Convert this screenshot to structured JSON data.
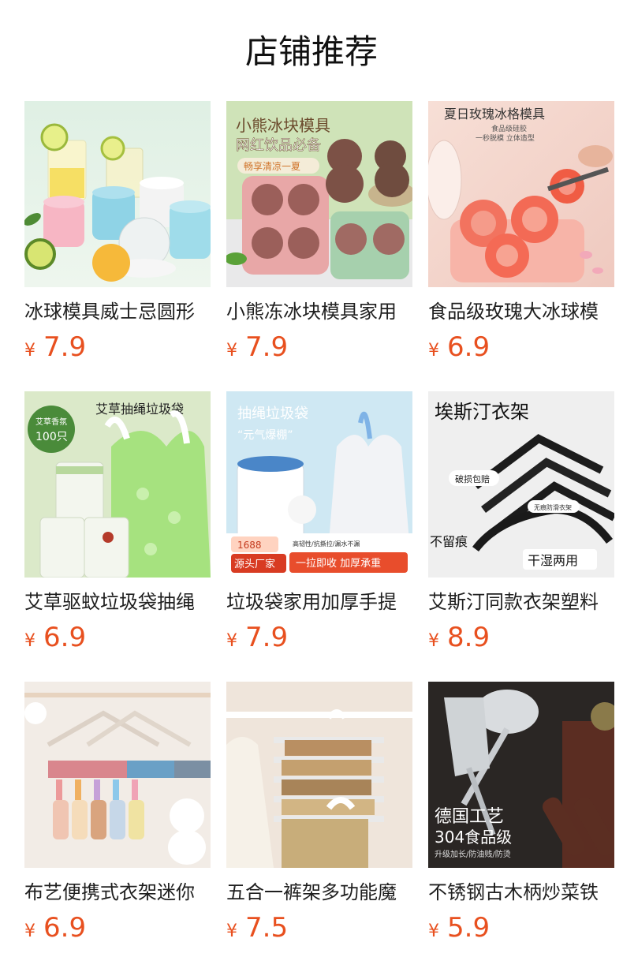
{
  "page": {
    "title": "店铺推荐"
  },
  "colors": {
    "price": "#e8501f",
    "text": "#1f1f1f"
  },
  "products": [
    {
      "name": "冰球模具威士忌圆形",
      "currency": "¥",
      "price": "7.9",
      "image": "ice-ball-molds-image"
    },
    {
      "name": "小熊冻冰块模具家用",
      "currency": "¥",
      "price": "7.9",
      "image": "bear-ice-mold-image",
      "image_text": {
        "line1": "小熊冰块模具",
        "line2": "网红饮品必备",
        "line3": "畅享清凉一夏"
      }
    },
    {
      "name": "食品级玫瑰大冰球模",
      "currency": "¥",
      "price": "6.9",
      "image": "rose-ice-mold-image",
      "image_text": {
        "line1": "夏日玫瑰冰格模具",
        "line2": "食品级硅胶",
        "line3": "一秒脱模 立体造型"
      }
    },
    {
      "name": "艾草驱蚊垃圾袋抽绳",
      "currency": "¥",
      "price": "6.9",
      "image": "mugwort-trash-bag-image",
      "image_text": {
        "line1": "艾草抽绳垃圾袋",
        "badge1": "艾草香氛",
        "badge2": "100只"
      }
    },
    {
      "name": "垃圾袋家用加厚手提",
      "currency": "¥",
      "price": "7.9",
      "image": "drawstring-trash-bag-image",
      "image_text": {
        "line1": "抽绳垃圾袋",
        "line2": "“元气爆棚”",
        "badge1": "1688",
        "badge2": "源头厂家",
        "line3": "高韧性/抗撕拉/漏水不漏",
        "line4": "一拉即收 加厚承重"
      }
    },
    {
      "name": "艾斯汀同款衣架塑料",
      "currency": "¥",
      "price": "8.9",
      "image": "black-hangers-image",
      "image_text": {
        "line1": "埃斯汀衣架",
        "line2": "破损包赔",
        "line3": "无痕防滑衣架",
        "line4": "不留痕",
        "line5": "干湿两用"
      }
    },
    {
      "name": "布艺便携式衣架迷你",
      "currency": "¥",
      "price": "6.9",
      "image": "sock-clip-hanger-image"
    },
    {
      "name": "五合一裤架多功能魔",
      "currency": "¥",
      "price": "7.5",
      "image": "pants-rack-image"
    },
    {
      "name": "不锈钢古木柄炒菜铁",
      "currency": "¥",
      "price": "5.9",
      "image": "steel-spatula-ladle-image",
      "image_text": {
        "line1": "德国工艺",
        "line2": "304食品级",
        "line3": "升级加长/防油贱/防烫"
      }
    }
  ]
}
